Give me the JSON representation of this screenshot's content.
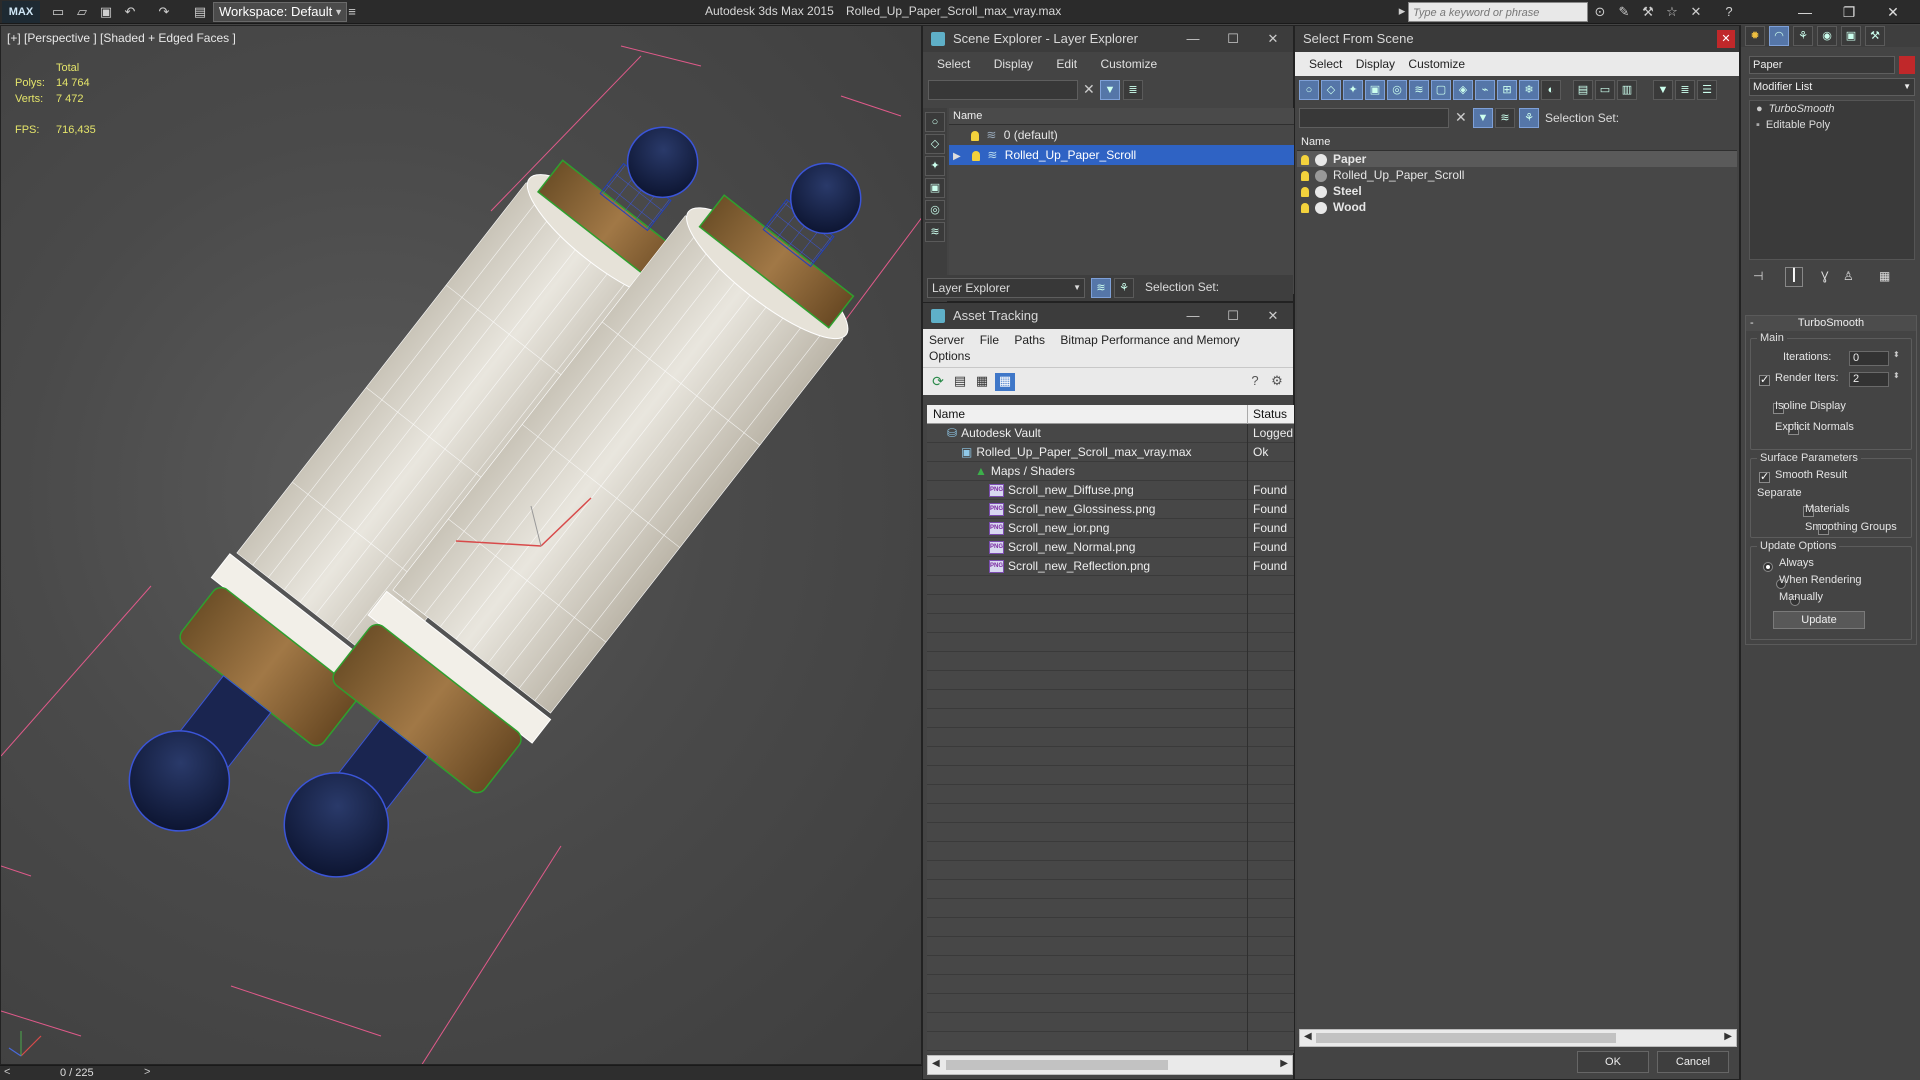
{
  "titlebar": {
    "logo": "MAX",
    "workspace": "Workspace: Default",
    "app": "Autodesk 3ds Max  2015",
    "document": "Rolled_Up_Paper_Scroll_max_vray.max",
    "search_placeholder": "Type a keyword or phrase"
  },
  "viewport": {
    "label": "[+] [Perspective ] [Shaded + Edged Faces ]",
    "stats": {
      "total_label": "Total",
      "polys_label": "Polys:",
      "polys": "14 764",
      "verts_label": "Verts:",
      "verts": "7 472",
      "fps_label": "FPS:",
      "fps": "716,435"
    }
  },
  "timeline": {
    "position": "0 / 225"
  },
  "scene_explorer": {
    "title": "Scene Explorer - Layer Explorer",
    "menu": [
      "Select",
      "Display",
      "Edit",
      "Customize"
    ],
    "column_name": "Name",
    "layers": [
      {
        "name": "0 (default)",
        "selected": false
      },
      {
        "name": "Rolled_Up_Paper_Scroll",
        "selected": true
      }
    ],
    "footer_dropdown": "Layer Explorer",
    "selection_set_label": "Selection Set:"
  },
  "asset_tracking": {
    "title": "Asset Tracking",
    "menu": [
      "Server",
      "File",
      "Paths",
      "Bitmap Performance and Memory",
      "Options"
    ],
    "columns": {
      "name": "Name",
      "status": "Status"
    },
    "rows": [
      {
        "name": "Autodesk Vault",
        "status": "Logged O",
        "indent": 0,
        "icon": "vault-icon"
      },
      {
        "name": "Rolled_Up_Paper_Scroll_max_vray.max",
        "status": "Ok",
        "indent": 1,
        "icon": "max-file-icon"
      },
      {
        "name": "Maps / Shaders",
        "status": "",
        "indent": 2,
        "icon": "maps-icon"
      },
      {
        "name": "Scroll_new_Diffuse.png",
        "status": "Found",
        "indent": 3,
        "icon": "png-icon"
      },
      {
        "name": "Scroll_new_Glossiness.png",
        "status": "Found",
        "indent": 3,
        "icon": "png-icon"
      },
      {
        "name": "Scroll_new_ior.png",
        "status": "Found",
        "indent": 3,
        "icon": "png-icon"
      },
      {
        "name": "Scroll_new_Normal.png",
        "status": "Found",
        "indent": 3,
        "icon": "png-icon"
      },
      {
        "name": "Scroll_new_Reflection.png",
        "status": "Found",
        "indent": 3,
        "icon": "png-icon"
      }
    ],
    "png_glyph": "PNG"
  },
  "select_from_scene": {
    "title": "Select From Scene",
    "menu": [
      "Select",
      "Display",
      "Customize"
    ],
    "selection_set_label": "Selection Set:",
    "column_name": "Name",
    "items": [
      {
        "name": "Paper",
        "bold": true,
        "highlight": true
      },
      {
        "name": "Rolled_Up_Paper_Scroll",
        "bold": false,
        "highlight": false
      },
      {
        "name": "Steel",
        "bold": true,
        "highlight": false
      },
      {
        "name": "Wood",
        "bold": true,
        "highlight": false
      }
    ],
    "ok": "OK",
    "cancel": "Cancel"
  },
  "command_panel": {
    "object_name": "Paper",
    "object_color": "#c0282a",
    "modifier_list": "Modifier List",
    "stack": [
      "TurboSmooth",
      "Editable Poly"
    ],
    "rollout_title": "TurboSmooth",
    "main_group": "Main",
    "iterations_label": "Iterations:",
    "iterations": "0",
    "render_iters_label": "Render Iters:",
    "render_iters": "2",
    "render_iters_checked": true,
    "isoline_display": "Isoline Display",
    "isoline_display_checked": false,
    "explicit_normals": "Explicit Normals",
    "explicit_normals_checked": false,
    "surface_group": "Surface Parameters",
    "smooth_result": "Smooth Result",
    "smooth_result_checked": true,
    "separate_label": "Separate",
    "materials": "Materials",
    "materials_checked": false,
    "smoothing_groups": "Smoothing Groups",
    "smoothing_groups_checked": false,
    "update_group": "Update Options",
    "update_options": [
      {
        "label": "Always",
        "selected": true
      },
      {
        "label": "When Rendering",
        "selected": false
      },
      {
        "label": "Manually",
        "selected": false
      }
    ],
    "update_button": "Update"
  }
}
